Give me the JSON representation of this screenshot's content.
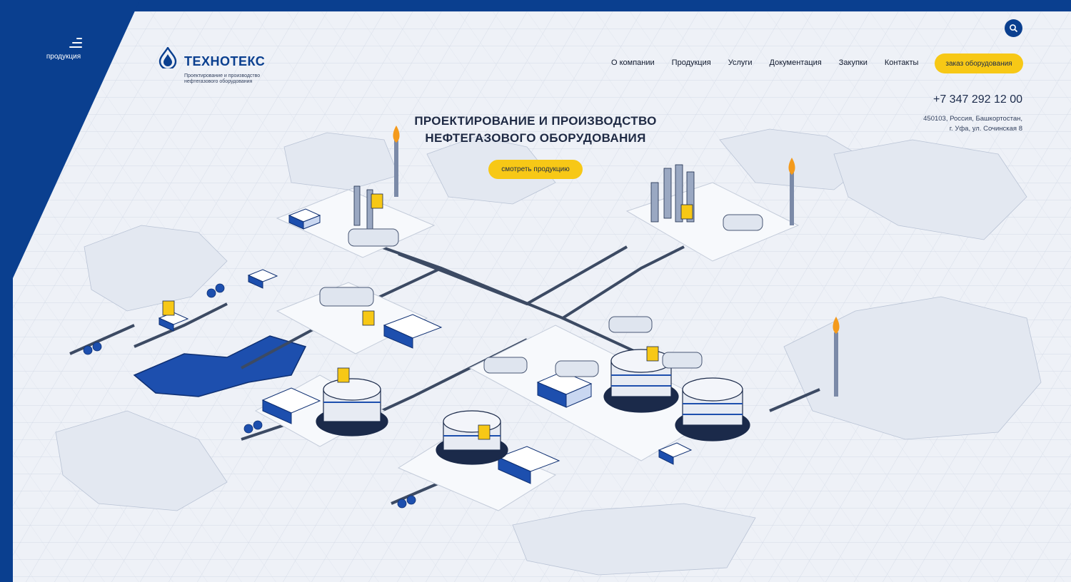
{
  "sidebar": {
    "menu_label": "продукция"
  },
  "logo": {
    "name": "ТЕХНОТЕКС",
    "tagline": "Проектирование и производство нефтегазового оборудования"
  },
  "nav": {
    "items": [
      {
        "label": "О компании"
      },
      {
        "label": "Продукция"
      },
      {
        "label": "Услуги"
      },
      {
        "label": "Документация"
      },
      {
        "label": "Закупки"
      },
      {
        "label": "Контакты"
      }
    ],
    "order_button": "заказ оборудования"
  },
  "contacts": {
    "phone": "+7 347 292 12 00",
    "address_line1": "450103, Россия, Башкортостан,",
    "address_line2": "г. Уфа, ул. Сочинская 8"
  },
  "hero": {
    "title_line1": "ПРОЕКТИРОВАНИЕ И ПРОИЗВОДСТВО",
    "title_line2": "НЕФТЕГАЗОВОГО ОБОРУДОВАНИЯ",
    "button": "смотреть продукцию"
  },
  "icons": {
    "menu": "menu-icon",
    "search": "search-icon",
    "logo": "oil-drop-logo-icon"
  },
  "colors": {
    "brand_blue": "#0a3f8f",
    "accent_yellow": "#f7c816",
    "background": "#eef1f7"
  }
}
